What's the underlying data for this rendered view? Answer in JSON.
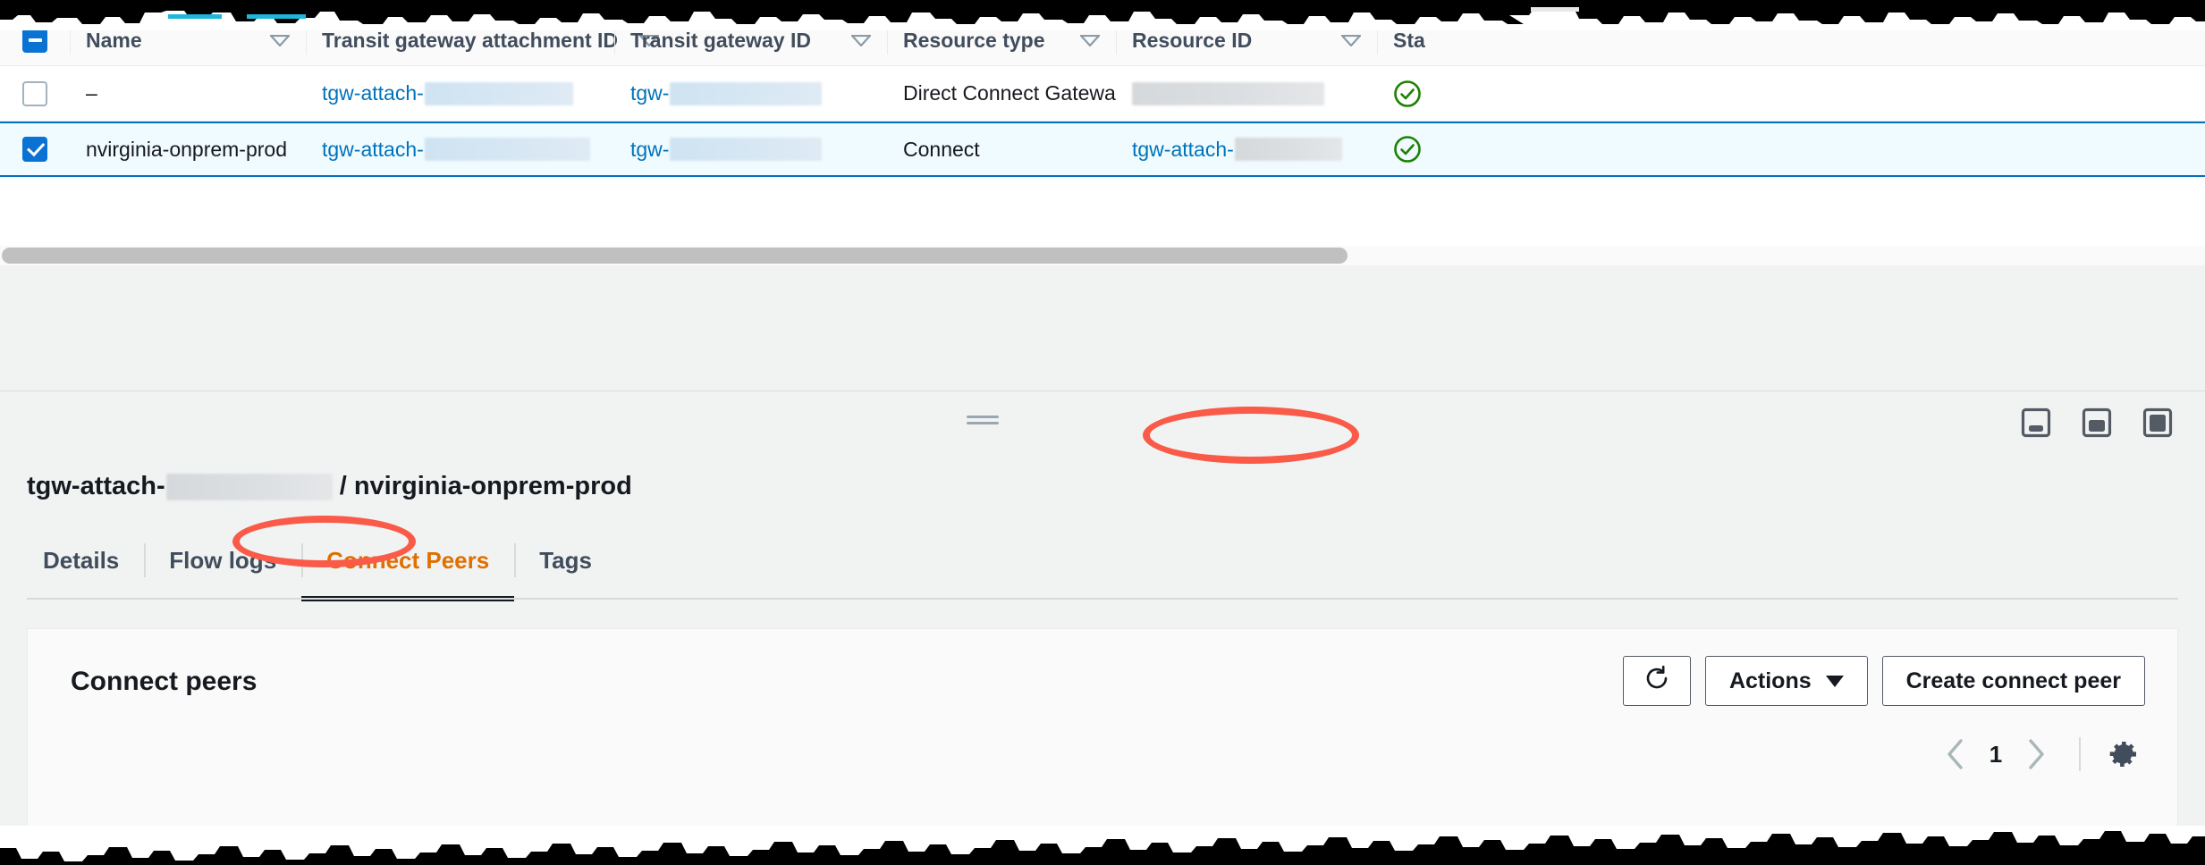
{
  "table": {
    "select_all_checkbox_state": "indeterminate",
    "columns": [
      {
        "key": "name",
        "label": "Name"
      },
      {
        "key": "tgw_attachment_id",
        "label": "Transit gateway attachment ID"
      },
      {
        "key": "tgw_id",
        "label": "Transit gateway ID"
      },
      {
        "key": "resource_type",
        "label": "Resource type"
      },
      {
        "key": "resource_id",
        "label": "Resource ID"
      },
      {
        "key": "status",
        "label": "Sta"
      }
    ],
    "rows": [
      {
        "selected": false,
        "name": "–",
        "tgw_attachment_id_prefix": "tgw-attach-",
        "tgw_attachment_id_redacted": true,
        "tgw_id_prefix": "tgw-",
        "tgw_id_redacted": true,
        "resource_type": "Direct Connect Gateway",
        "resource_id_prefix": "",
        "resource_id_redacted": true,
        "status_icon": "check-circle-icon"
      },
      {
        "selected": true,
        "name": "nvirginia-onprem-prod",
        "tgw_attachment_id_prefix": "tgw-attach-",
        "tgw_attachment_id_redacted": true,
        "tgw_id_prefix": "tgw-",
        "tgw_id_redacted": true,
        "resource_type": "Connect",
        "resource_id_prefix": "tgw-attach-",
        "resource_id_redacted": true,
        "status_icon": "check-circle-icon"
      }
    ]
  },
  "split_panel": {
    "header_prefix": "tgw-attach-",
    "header_separator": " / ",
    "header_name": "nvirginia-onprem-prod",
    "size_controls": [
      "panel-size-small-icon",
      "panel-size-medium-icon",
      "panel-size-large-icon"
    ],
    "drag_handle": "split-panel-drag-handle",
    "tabs": [
      {
        "label": "Details",
        "active": false
      },
      {
        "label": "Flow logs",
        "active": false
      },
      {
        "label": "Connect Peers",
        "active": true
      },
      {
        "label": "Tags",
        "active": false
      }
    ]
  },
  "connect_peers": {
    "title": "Connect peers",
    "refresh_label": "refresh-icon",
    "actions_label": "Actions",
    "create_label": "Create connect peer",
    "pagination": {
      "prev": "chevron-left-icon",
      "page": "1",
      "next": "chevron-right-icon",
      "settings": "gear-icon"
    }
  },
  "annotations": [
    {
      "name": "connect-peers-tab-highlight",
      "color": "#fa5a48"
    },
    {
      "name": "create-connect-peer-highlight",
      "color": "#fa5a48"
    }
  ],
  "colors": {
    "link": "#0073bb",
    "selected_row_bg": "#f0fbff",
    "selected_row_border": "#0073bb",
    "active_tab": "#e07000",
    "status_ok": "#1d8102",
    "annotation": "#fa5a48"
  }
}
